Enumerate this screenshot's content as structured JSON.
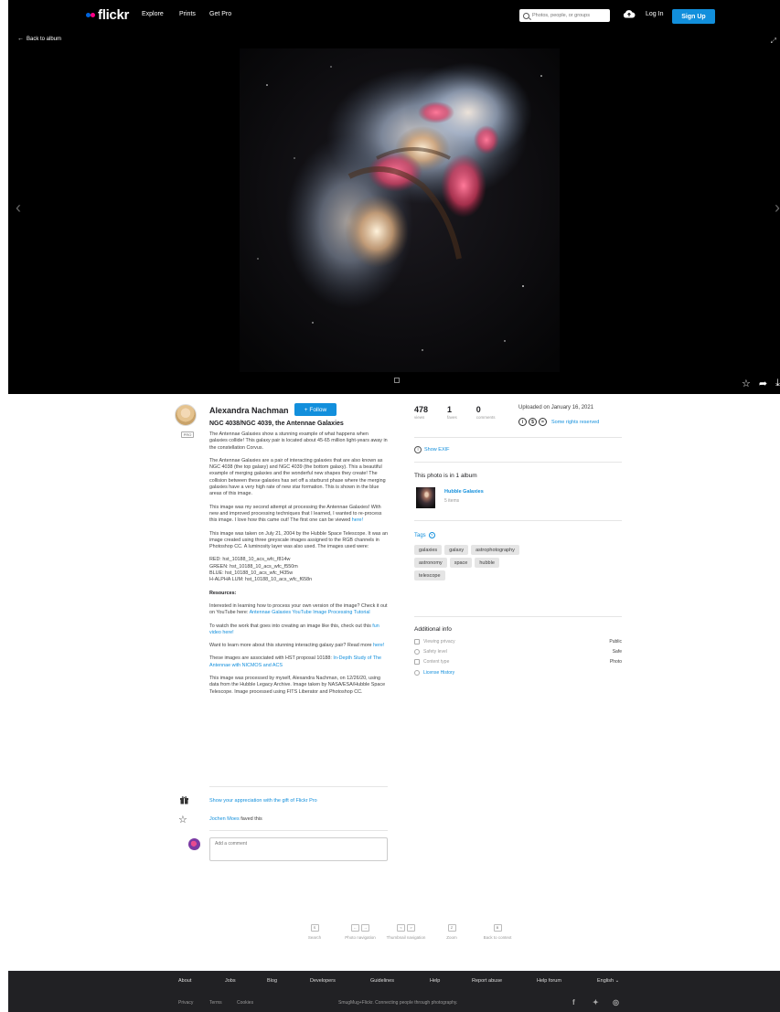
{
  "nav": {
    "logo": "flickr",
    "links": [
      "Explore",
      "Prints",
      "Get Pro"
    ],
    "search_placeholder": "Photos, people, or groups",
    "login": "Log In",
    "signup": "Sign Up",
    "colors": {
      "brand_blue": "#0063dc",
      "brand_pink": "#ff0084",
      "cta": "#128fdc"
    }
  },
  "viewer": {
    "back": "Back to album"
  },
  "photo": {
    "author": "Alexandra Nachman",
    "follow": "+ Follow",
    "pro": "PRO",
    "title": "NGC 4038/NGC 4039, the Antennae Galaxies",
    "desc": {
      "p1": "The Antennae Galaxies show a stunning example of what happens when galaxies collide! This galaxy pair is located about 45-65 million light-years away in the constellation Corvus.",
      "p2": "The Antennae Galaxies are a pair of interacting galaxies that are also known as NGC 4038 (the top galaxy) and NGC 4039 (the bottom galaxy). This a beautiful example of merging galaxies and the wonderful new shapes they create! The collision between these galaxies has set off a starburst phase where the merging galaxies have a very high rate of new star formation. This is shown in the blue areas of this image.",
      "p3": "This image was my second attempt at processing the Antennae Galaxies! With new and improved processing techniques that I learned, I wanted to re-process this image. I love how this came out! The first one can be viewed",
      "p3_link": "here!",
      "p4": "This image was taken on July 21, 2004 by the Hubble Space Telescope. It was an image created using three greyscale images assigned to the RGB channels in Photoshop CC. A luminosity layer was also used. The images used were:",
      "red": "RED: hst_10188_10_acs_wfc_f814w",
      "green": "GREEN: hst_10188_10_acs_wfc_f550m",
      "blue": "BLUE: hst_10188_10_acs_wfc_f435w",
      "halpha": "H-ALPHA LUM: hst_10188_10_acs_wfc_f658n",
      "resources": "Resources:",
      "p5": "Interested in learning how to process your own version of the image? Check it out on YouTube here:",
      "p5_link": "Antennae Galaxies YouTube Image Processing Tutorial",
      "p6": "To watch the work that goes into creating an image like this, check out this",
      "p6_link": "fun video here!",
      "p7": "Want to learn more about this stunning interacting galaxy pair? Read more",
      "p7_link": "here!",
      "p8": "These images are associated with HST proposal 10188:",
      "p8_link": "In-Depth Study of The Antennae with NICMOS and ACS",
      "p9": "This image was processed by myself, Alexandra Nachman, on 12/26/20, using data from the Hubble Legacy Archive. Image taken by NASA/ESA/Hubble Space Telescope. Image processed using FITS Liberator and Photoshop CC."
    },
    "gift": "Show your appreciation with the gift of Flickr Pro",
    "faver": "Jochen Moes",
    "faved_suffix": "faved this",
    "comment_placeholder": "Add a comment"
  },
  "shortcuts": [
    {
      "keys": [
        "S"
      ],
      "label": "Search"
    },
    {
      "keys": [
        "←",
        "→"
      ],
      "label": "Photo navigation"
    },
    {
      "keys": [
        "<",
        ">"
      ],
      "label": "Thumbnail navigation"
    },
    {
      "keys": [
        "Z"
      ],
      "label": "Zoom"
    },
    {
      "keys": [
        "B"
      ],
      "label": "Back to context"
    }
  ],
  "stats": [
    {
      "num": "478",
      "label": "views"
    },
    {
      "num": "1",
      "label": "faves"
    },
    {
      "num": "0",
      "label": "comments"
    }
  ],
  "uploaded": "Uploaded on January 16, 2021",
  "license": "Some rights reserved",
  "exif": "Show EXIF",
  "album": {
    "heading": "This photo is in 1 album",
    "name": "Hubble Galaxies",
    "count": "5 items"
  },
  "tags_heading": "Tags",
  "tags": [
    "galaxies",
    "galaxy",
    "astrophotography",
    "astronomy",
    "space",
    "hubble",
    "telescope"
  ],
  "additional": {
    "heading": "Additional info",
    "rows": [
      {
        "k": "Viewing privacy",
        "v": "Public"
      },
      {
        "k": "Safety level",
        "v": "Safe"
      },
      {
        "k": "Content type",
        "v": "Photo"
      }
    ],
    "license_history": "License History"
  },
  "footer": {
    "links": [
      "About",
      "Jobs",
      "Blog",
      "Developers",
      "Guidelines",
      "Help",
      "Report abuse",
      "Help forum",
      "English"
    ],
    "privacy": "Privacy",
    "terms": "Terms",
    "cookies": "Cookies",
    "tagline": "SmugMug+Flickr. Connecting people through photography."
  }
}
